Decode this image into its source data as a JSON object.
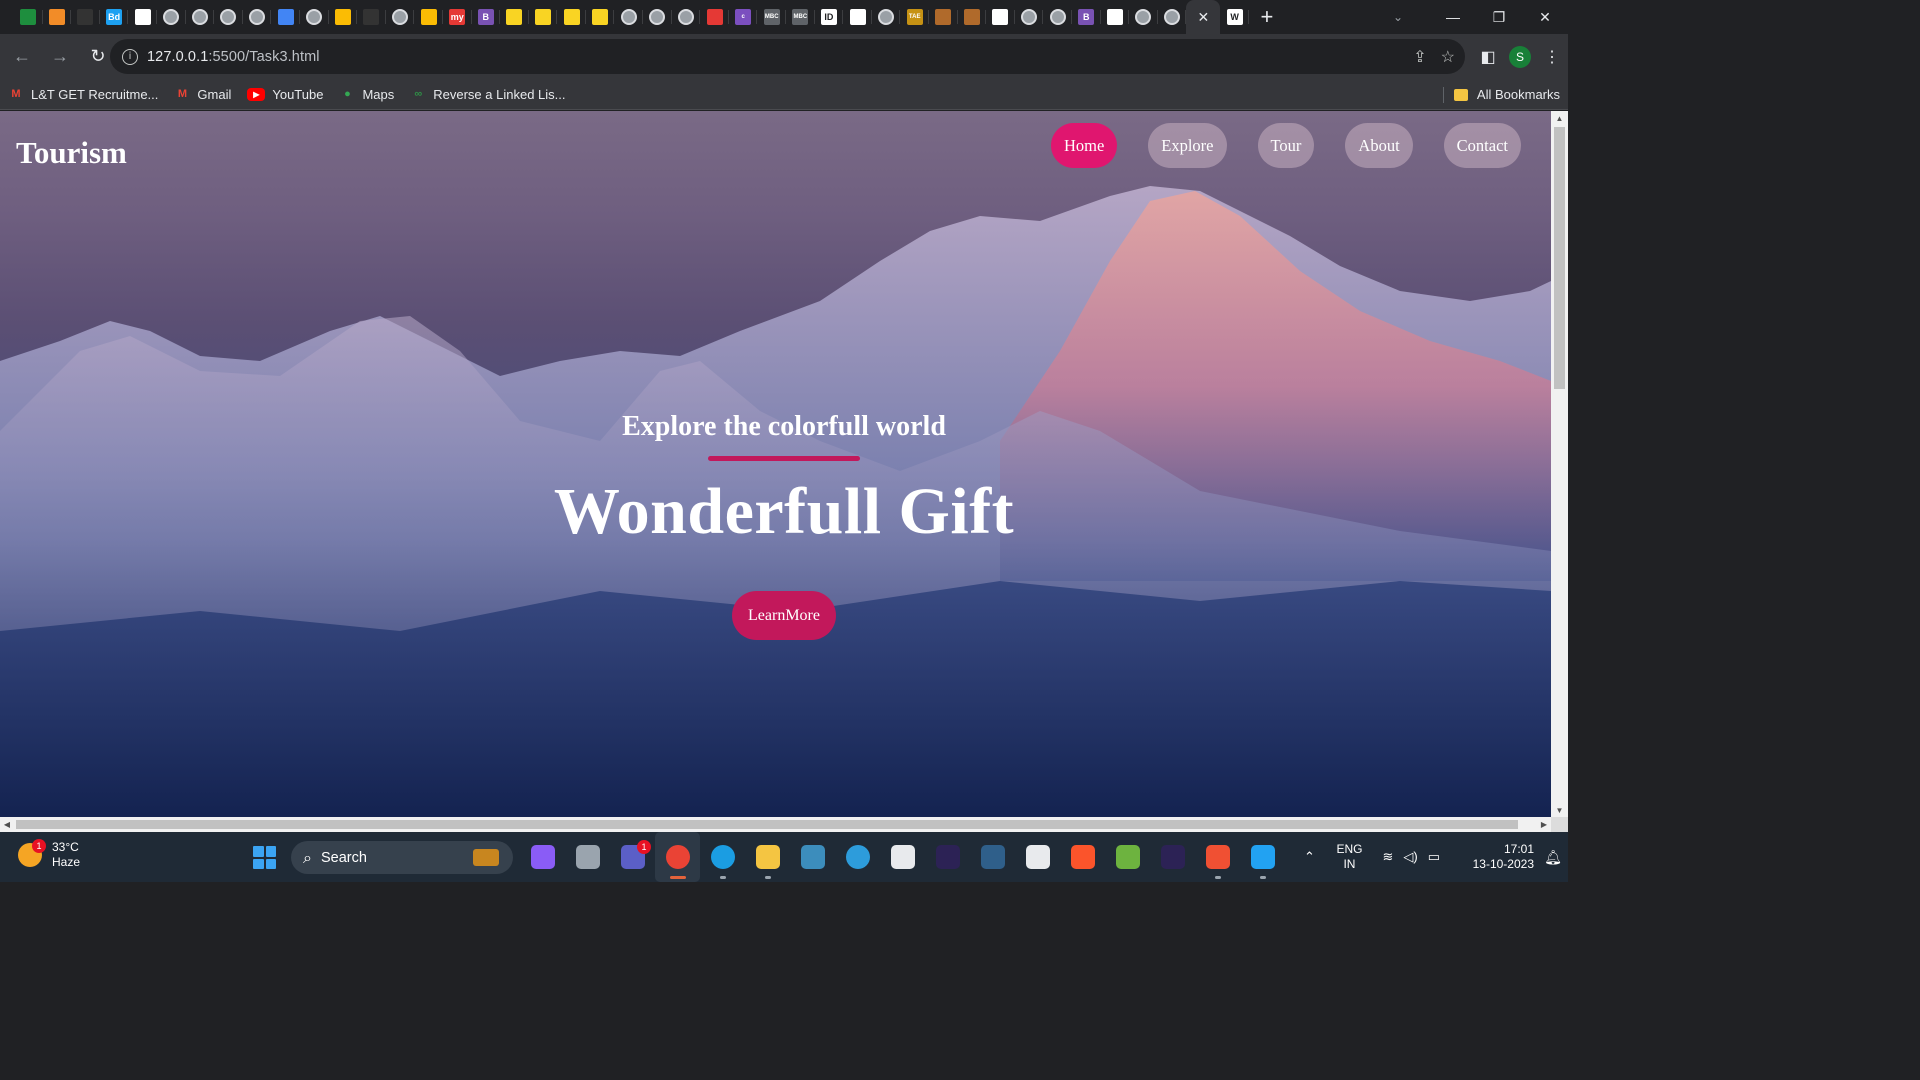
{
  "browser": {
    "tabs": [
      {
        "icon": "green-chart-icon",
        "color": "#1e8e3e"
      },
      {
        "icon": "pencil-icon",
        "color": "#f28c28"
      },
      {
        "icon": "dark-app-icon",
        "color": "#333333"
      },
      {
        "icon": "bd-icon",
        "color": "#1da1f2",
        "text": "Bd"
      },
      {
        "icon": "openai-icon",
        "color": "#ffffff"
      },
      {
        "icon": "globe-icon",
        "color": "#9aa0a6"
      },
      {
        "icon": "globe-icon",
        "color": "#9aa0a6"
      },
      {
        "icon": "globe-icon",
        "color": "#9aa0a6"
      },
      {
        "icon": "globe-icon",
        "color": "#9aa0a6"
      },
      {
        "icon": "map-icon",
        "color": "#4285f4"
      },
      {
        "icon": "globe-icon",
        "color": "#9aa0a6"
      },
      {
        "icon": "colorful-app-icon",
        "color": "#fbbc04"
      },
      {
        "icon": "dark-app-icon",
        "color": "#333333"
      },
      {
        "icon": "globe-icon",
        "color": "#9aa0a6"
      },
      {
        "icon": "smiley-icon",
        "color": "#fbbc04"
      },
      {
        "icon": "my-icon",
        "color": "#e53935",
        "text": "my"
      },
      {
        "icon": "bootstrap-icon",
        "color": "#7952b3",
        "text": "B"
      },
      {
        "icon": "flipkart-icon",
        "color": "#f9d423"
      },
      {
        "icon": "flipkart-icon",
        "color": "#f9d423"
      },
      {
        "icon": "flipkart-icon",
        "color": "#f9d423"
      },
      {
        "icon": "flipkart-icon",
        "color": "#f9d423"
      },
      {
        "icon": "globe-icon",
        "color": "#9aa0a6"
      },
      {
        "icon": "globe-icon",
        "color": "#9aa0a6"
      },
      {
        "icon": "globe-icon",
        "color": "#9aa0a6"
      },
      {
        "icon": "adobe-icon",
        "color": "#e53935"
      },
      {
        "icon": "colorlib-icon",
        "color": "#7b4fbf",
        "text": "colorlib"
      },
      {
        "icon": "mbc-icon",
        "color": "#5f6368",
        "text": "MBC"
      },
      {
        "icon": "mbc-icon",
        "color": "#5f6368",
        "text": "MBC"
      },
      {
        "icon": "id-icon",
        "color": "#ffffff",
        "text": "ID"
      },
      {
        "icon": "chrome-icon",
        "color": "#ffffff"
      },
      {
        "icon": "globe-icon",
        "color": "#9aa0a6"
      },
      {
        "icon": "tae-icon",
        "color": "#c69214",
        "text": "TAE"
      },
      {
        "icon": "brown-app-icon",
        "color": "#b06a2b"
      },
      {
        "icon": "brown-app-icon",
        "color": "#b06a2b"
      },
      {
        "icon": "chrome-icon",
        "color": "#ffffff"
      },
      {
        "icon": "globe-icon",
        "color": "#9aa0a6"
      },
      {
        "icon": "globe-icon",
        "color": "#9aa0a6"
      },
      {
        "icon": "bootstrap-icon",
        "color": "#7952b3",
        "text": "B"
      },
      {
        "icon": "chrome-icon",
        "color": "#ffffff"
      },
      {
        "icon": "globe-icon",
        "color": "#9aa0a6"
      },
      {
        "icon": "globe-icon",
        "color": "#9aa0a6"
      }
    ],
    "active_tab": {
      "icon": "close-icon",
      "symbol": "✕"
    },
    "after_active_tab": {
      "icon": "wikipedia-icon",
      "text": "W"
    },
    "new_tab_symbol": "+",
    "tab_search_symbol": "⌄",
    "window": {
      "minimize": "—",
      "maximize": "❐",
      "close": "✕"
    },
    "url_host": "127.0.0.1",
    "url_rest": ":5500/Task3.html",
    "profile_initial": "S",
    "bookmarks": [
      {
        "label": "L&T GET Recruitme...",
        "icon": "gmail-icon"
      },
      {
        "label": "Gmail",
        "icon": "gmail-icon"
      },
      {
        "label": "YouTube",
        "icon": "youtube-icon"
      },
      {
        "label": "Maps",
        "icon": "maps-icon"
      },
      {
        "label": "Reverse a Linked Lis...",
        "icon": "gfg-icon"
      }
    ],
    "all_bookmarks": "All Bookmarks"
  },
  "page": {
    "brand": "Tourism",
    "nav": [
      {
        "label": "Home",
        "active": true
      },
      {
        "label": "Explore",
        "active": false
      },
      {
        "label": "Tour",
        "active": false
      },
      {
        "label": "About",
        "active": false
      },
      {
        "label": "Contact",
        "active": false
      }
    ],
    "subtitle": "Explore the colorfull world",
    "title": "Wonderfull Gift",
    "cta": "LearnMore",
    "accent": "#e0166f"
  },
  "taskbar": {
    "weather_temp": "33°C",
    "weather_desc": "Haze",
    "weather_badge": "1",
    "search_label": "Search",
    "apps": [
      {
        "icon": "copilot-icon",
        "color": "#8a5cf6"
      },
      {
        "icon": "task-view-icon",
        "color": "#9aa4ae"
      },
      {
        "icon": "teams-icon",
        "color": "#5b5fc7",
        "badge": "1"
      },
      {
        "icon": "chrome-icon",
        "color": "#ea4335",
        "active": true
      },
      {
        "icon": "edge-icon",
        "color": "#1b9de2"
      },
      {
        "icon": "file-explorer-icon",
        "color": "#f4c542"
      },
      {
        "icon": "mysql-icon",
        "color": "#3c8dbc"
      },
      {
        "icon": "help-icon",
        "color": "#2d9cdb"
      },
      {
        "icon": "store-icon",
        "color": "#e8eaed"
      },
      {
        "icon": "eclipse-icon",
        "color": "#2c2255"
      },
      {
        "icon": "mysql-workbench-icon",
        "color": "#2f5f8a"
      },
      {
        "icon": "notepad-icon",
        "color": "#e8eaed"
      },
      {
        "icon": "brave-icon",
        "color": "#fb542b"
      },
      {
        "icon": "spring-icon",
        "color": "#6db33f"
      },
      {
        "icon": "eclipse-icon",
        "color": "#2c2255"
      },
      {
        "icon": "git-icon",
        "color": "#f05033"
      },
      {
        "icon": "vscode-icon",
        "color": "#22a2f2"
      }
    ],
    "lang_top": "ENG",
    "lang_bottom": "IN",
    "time": "17:01",
    "date": "13-10-2023"
  }
}
